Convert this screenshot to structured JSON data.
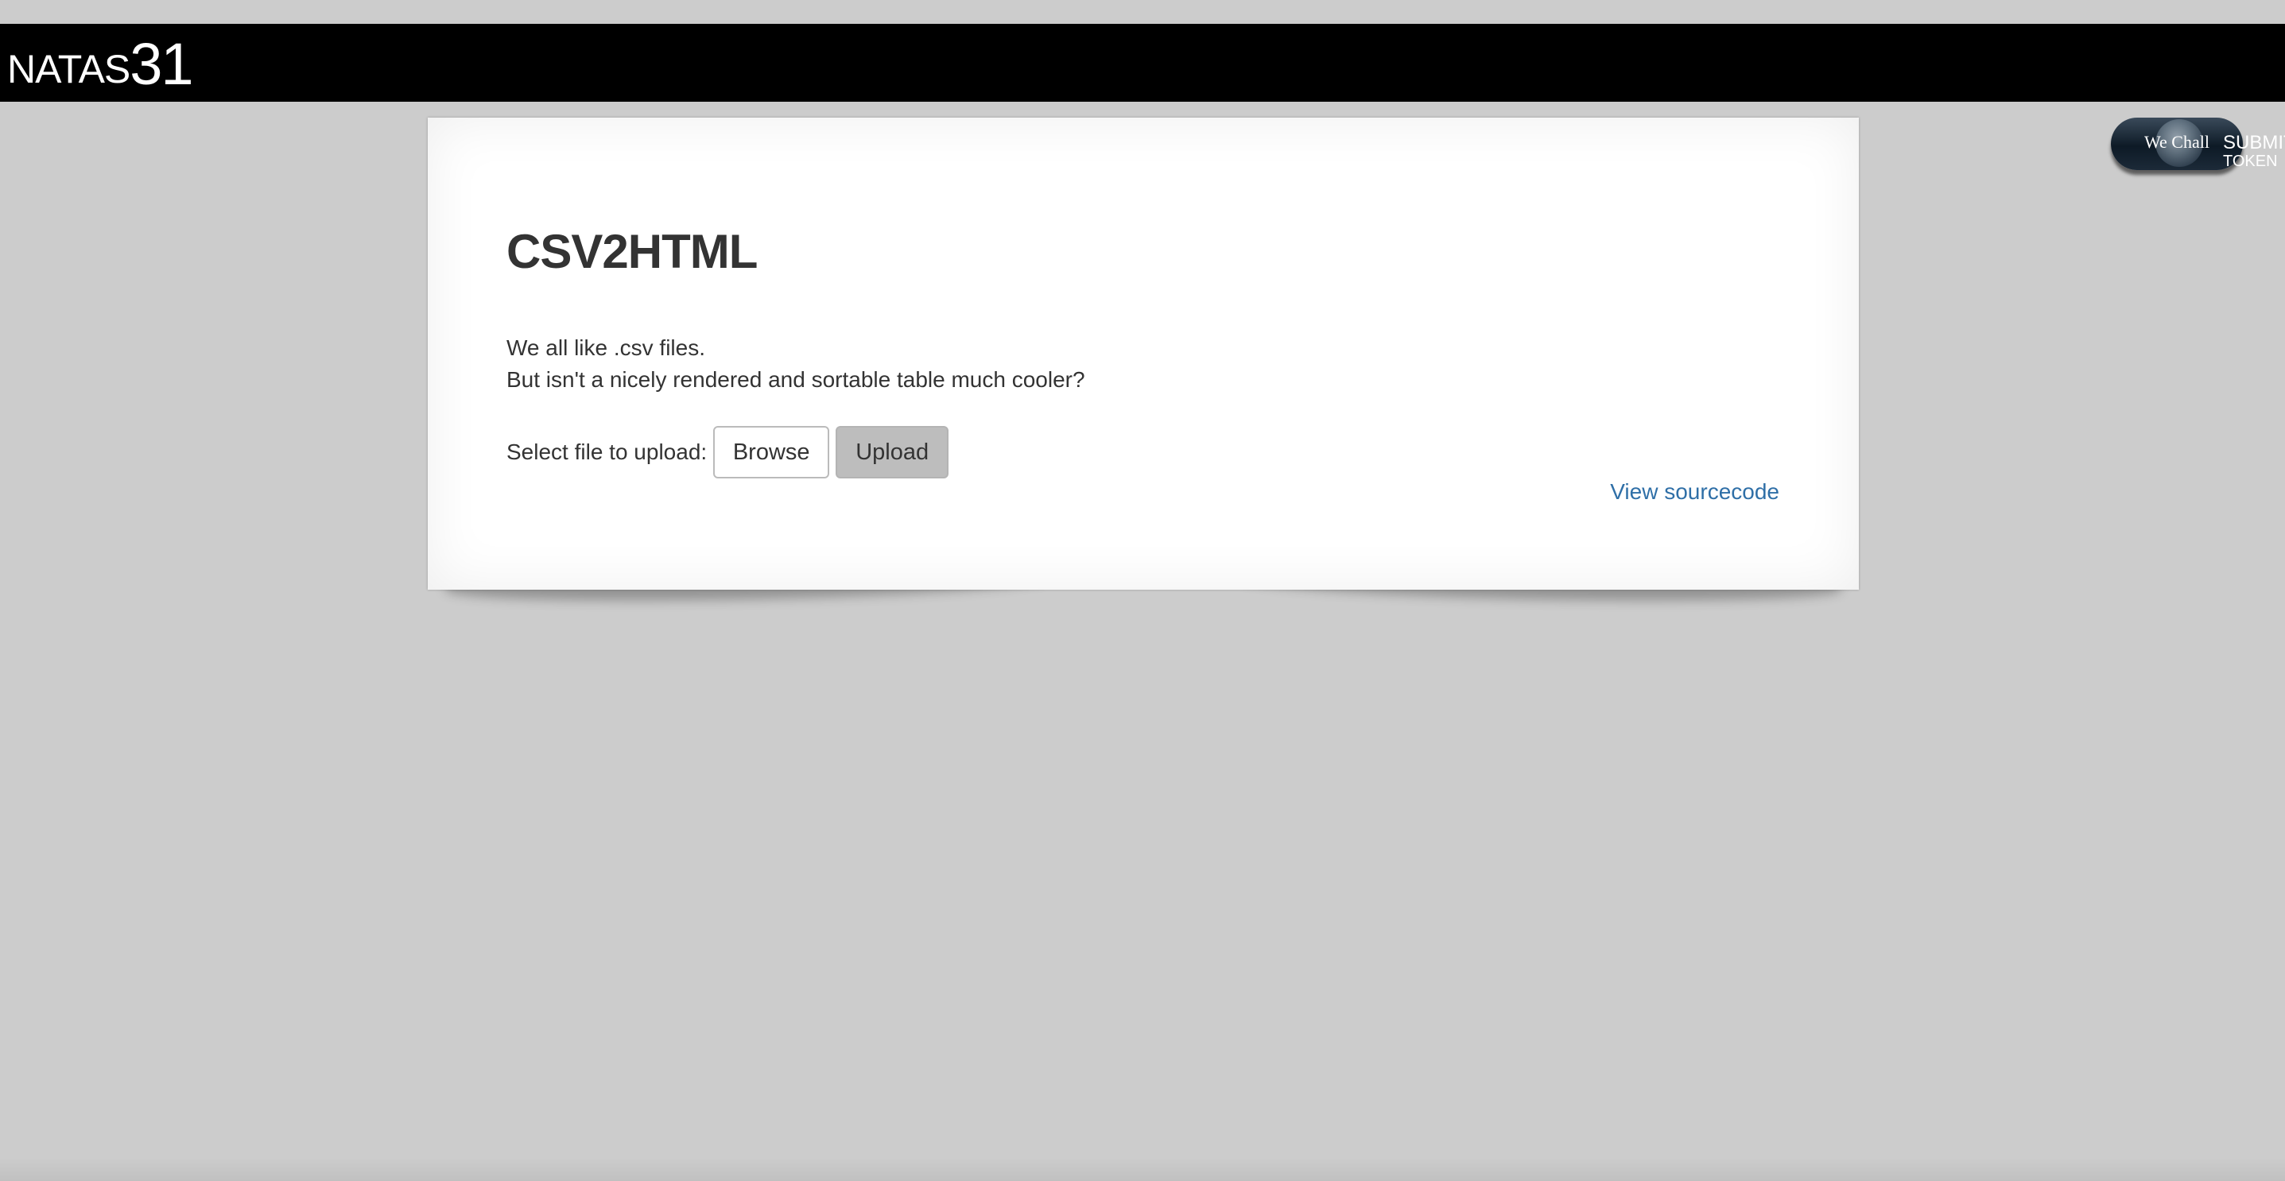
{
  "header": {
    "logo_name": "NATAS",
    "logo_number": "31"
  },
  "wechall": {
    "label": "We Chall",
    "submit_line1": "SUBMIT",
    "submit_line2": "TOKEN"
  },
  "content": {
    "title": "CSV2HTML",
    "intro_line1": "We all like .csv files.",
    "intro_line2": "But isn't a nicely rendered and sortable table much cooler?",
    "upload_label": "Select file to upload:",
    "browse_label": "Browse",
    "upload_button": "Upload",
    "view_source_link": "View sourcecode"
  },
  "colors": {
    "background": "#cccccc",
    "header": "#000000",
    "link": "#2f6fa7",
    "upload_button": "#bdbdbd"
  }
}
